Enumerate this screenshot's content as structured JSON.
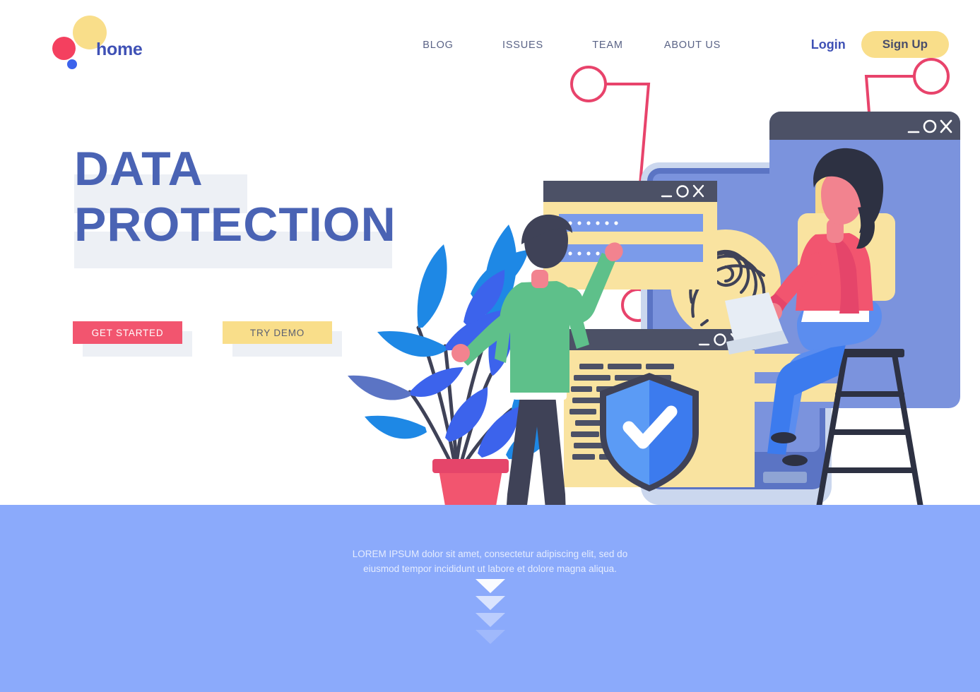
{
  "brand": {
    "name": "home",
    "logo_icon": "three-dots-logo",
    "colors": {
      "dot_yellow": "#F9DE8A",
      "dot_pink": "#F4405F",
      "dot_blue": "#3C63EC",
      "wordmark": "#3F51B5"
    }
  },
  "nav": {
    "items": [
      {
        "label": "BLOG",
        "name": "nav-item-blog"
      },
      {
        "label": "ISSUES",
        "name": "nav-item-issues"
      },
      {
        "label": "TEAM",
        "name": "nav-item-team"
      },
      {
        "label": "ABOUT US",
        "name": "nav-item-about-us"
      }
    ]
  },
  "auth": {
    "login_label": "Login",
    "signup_label": "Sign Up",
    "signup_bg": "#F9DE8A",
    "login_color": "#3F51B5"
  },
  "hero": {
    "headline_line1": "DATA",
    "headline_line2": "PROTECTION",
    "headline_color": "#4A63B4",
    "highlight_color": "#EDF0F5",
    "cta_primary": "GET STARTED",
    "cta_secondary": "TRY DEMO",
    "cta_primary_bg": "#F2556F",
    "cta_secondary_bg": "#F9DE8A"
  },
  "band": {
    "background": "#8BAAFB",
    "text": "LOREM IPSUM dolor sit amet, consectetur adipiscing elit, sed do eiusmod tempor incididunt ut labore et dolore magna aliqua.",
    "scroll_indicator": "four-chevron-down-icons"
  },
  "illustration": {
    "windows": [
      {
        "name": "login-window",
        "controls": "_ O X",
        "fields": 2,
        "field_mask": "••••••"
      },
      {
        "name": "padlock-window",
        "controls": "_ O X",
        "icon": "padlock-icon"
      },
      {
        "name": "document-window",
        "controls": "_ O X",
        "icon": "shield-check-icon"
      }
    ],
    "window_controls": {
      "minimize": "_",
      "maximize": "O",
      "close": "X"
    },
    "devices": [
      {
        "name": "tablet-device",
        "screen": "fingerprint-scanner"
      }
    ],
    "figures": [
      {
        "name": "man-reaching-figure",
        "shirt": "#5EC08A",
        "pants": "#3F4257"
      },
      {
        "name": "woman-on-ladder-figure",
        "shirt": "#F2556F",
        "pants": "#5B8DEF"
      }
    ],
    "decor": [
      {
        "name": "potted-plant",
        "pot": "#F2556F",
        "leaves": "#1E88E5"
      },
      {
        "name": "callout-connector-left",
        "color": "#E8436B"
      },
      {
        "name": "callout-connector-mid",
        "color": "#E8436B"
      },
      {
        "name": "callout-connector-right",
        "color": "#E8436B"
      }
    ]
  }
}
